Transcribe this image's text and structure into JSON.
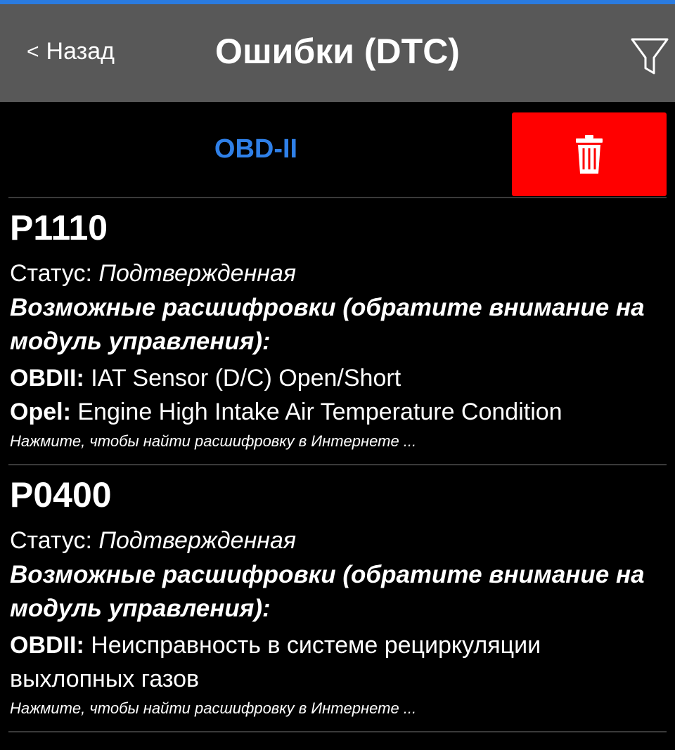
{
  "header": {
    "back_chevron": "<",
    "back_label": "Назад",
    "title": "Ошибки (DTC)",
    "filter_icon": "filter-icon"
  },
  "toolbar": {
    "tab_label": "OBD-II",
    "delete_icon": "trash-icon",
    "delete_color": "#ff0000",
    "accent_color": "#2f80e8"
  },
  "dtc": [
    {
      "code": "P1110",
      "status_label": "Статус:",
      "status_value": "Подтвержденная",
      "possible_label": "Возможные расшифровки (обратите внимание на модуль управления):",
      "decodings": [
        {
          "source": "OBDII:",
          "text": "IAT Sensor (D/C) Open/Short"
        },
        {
          "source": "Opel:",
          "text": "Engine High Intake Air Temperature Condition"
        }
      ],
      "search_hint": "Нажмите, чтобы найти расшифровку в Интернете ..."
    },
    {
      "code": "P0400",
      "status_label": "Статус:",
      "status_value": "Подтвержденная",
      "possible_label": "Возможные расшифровки (обратите внимание на модуль управления):",
      "decodings": [
        {
          "source": "OBDII:",
          "text": "Неисправность в системе рециркуляции выхлопных газов"
        }
      ],
      "search_hint": "Нажмите, чтобы найти расшифровку в Интернете ..."
    }
  ]
}
